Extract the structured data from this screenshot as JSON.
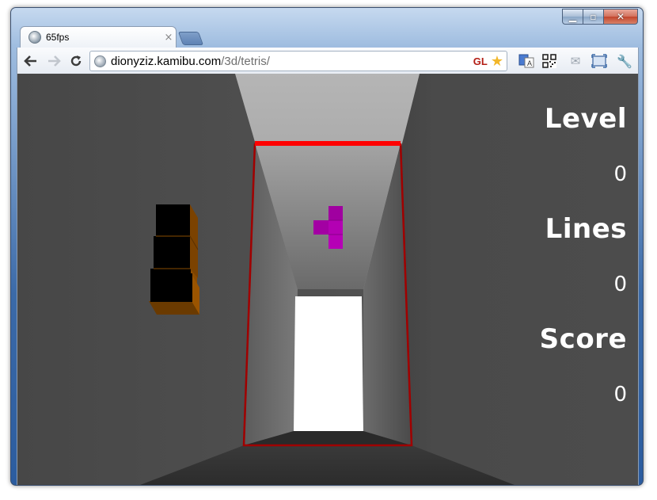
{
  "browser": {
    "tab_title": "65fps",
    "tab_close": "×",
    "url_host": "dionyziz.kamibu.com",
    "url_path": "/3d/tetris/",
    "gl_badge": "GL",
    "nav": {
      "back": "back-arrow",
      "forward": "forward-arrow",
      "reload": "reload-arrow"
    },
    "extensions": [
      "translate-icon",
      "qr-code-icon",
      "mail-icon",
      "fullscreen-icon",
      "wrench-icon"
    ]
  },
  "window_controls": {
    "minimize": "minimize-icon",
    "maximize": "maximize-icon",
    "close": "close-icon"
  },
  "hud": {
    "level_label": "Level",
    "level_value": "0",
    "lines_label": "Lines",
    "lines_value": "0",
    "score_label": "Score",
    "score_value": "0"
  },
  "game": {
    "current_piece": {
      "shape": "T",
      "color": "#b300b3"
    },
    "next_piece": {
      "shape": "L",
      "color": "#8b4b00"
    },
    "well_border_color": "#a00000",
    "well_top_color": "#ff0000"
  }
}
